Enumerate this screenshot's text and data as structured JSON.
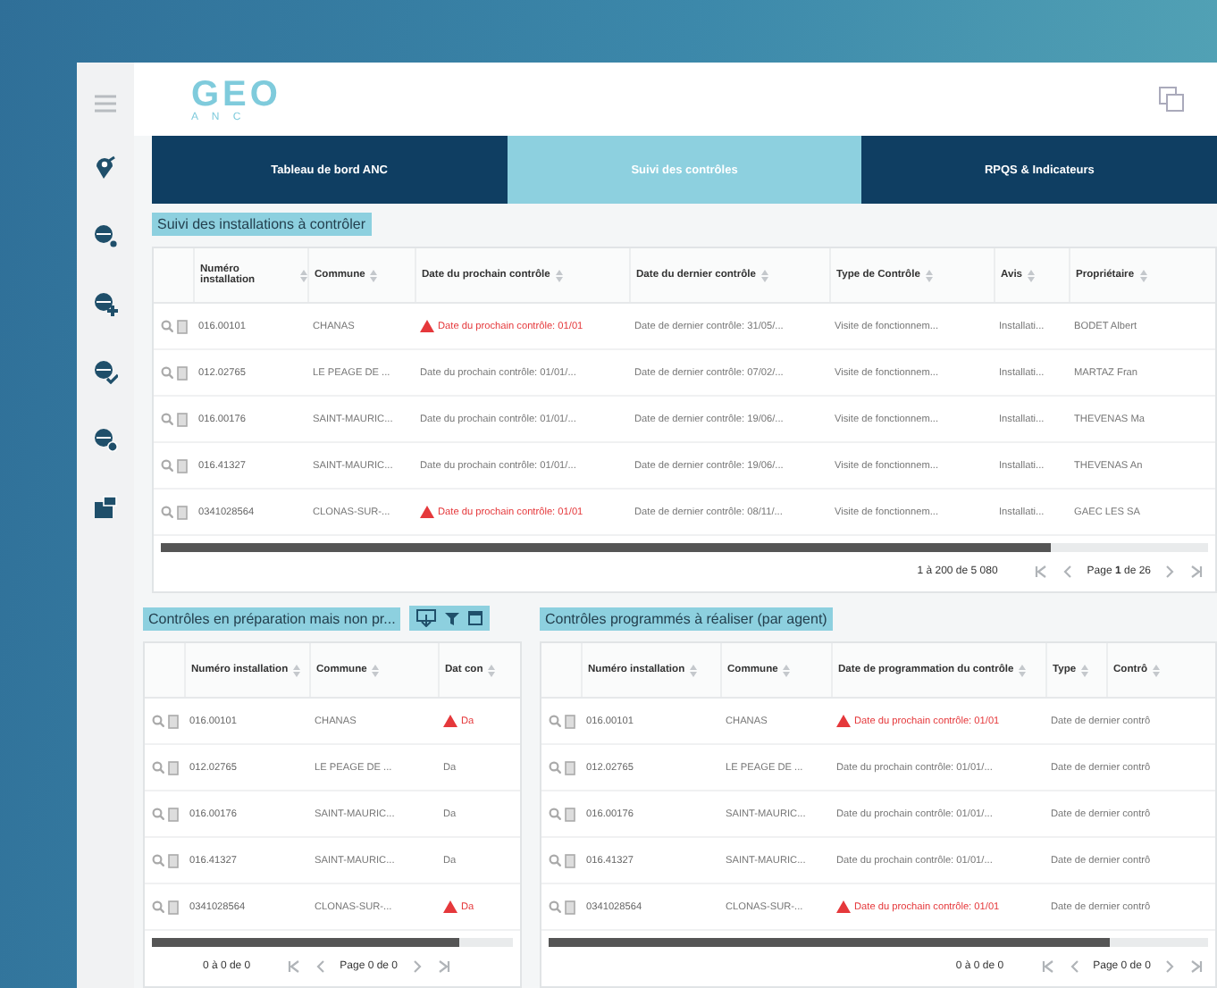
{
  "app": {
    "logo": "GEO",
    "logo_sub": "A N C"
  },
  "tabs": [
    {
      "label": "Tableau de bord ANC",
      "selected": false
    },
    {
      "label": "Suivi des contrôles",
      "selected": true
    },
    {
      "label": "RPQS & Indicateurs",
      "selected": false
    }
  ],
  "panels": [
    {
      "title": "Suivi des installations à contrôler",
      "toolbar": false,
      "columns": [
        {
          "label": "Numéro installation",
          "kind": "text"
        },
        {
          "label": "Commune",
          "kind": "text"
        },
        {
          "label": "Date du prochain contrôle",
          "kind": "due-date"
        },
        {
          "label": "Date du dernier contrôle",
          "kind": "text"
        },
        {
          "label": "Type de Contrôle",
          "kind": "text"
        },
        {
          "label": "Avis",
          "kind": "text"
        },
        {
          "label": "Propriétaire",
          "kind": "text"
        }
      ],
      "rows": [
        {
          "overdue": true,
          "cells": [
            "016.00101",
            "CHANAS",
            "Date du prochain contrôle: 01/01",
            "Date de dernier contrôle: 31/05/...",
            "Visite de fonctionnem...",
            "Installati...",
            "BODET Albert"
          ]
        },
        {
          "overdue": false,
          "cells": [
            "012.02765",
            "LE PEAGE DE ...",
            "Date du prochain contrôle: 01/01/...",
            "Date de dernier contrôle: 07/02/...",
            "Visite de fonctionnem...",
            "Installati...",
            "MARTAZ Fran"
          ]
        },
        {
          "overdue": false,
          "cells": [
            "016.00176",
            "SAINT-MAURIC...",
            "Date du prochain contrôle: 01/01/...",
            "Date de dernier contrôle: 19/06/...",
            "Visite de fonctionnem...",
            "Installati...",
            "THEVENAS Ma"
          ]
        },
        {
          "overdue": false,
          "cells": [
            "016.41327",
            "SAINT-MAURIC...",
            "Date du prochain contrôle: 01/01/...",
            "Date de dernier contrôle: 19/06/...",
            "Visite de fonctionnem...",
            "Installati...",
            "THEVENAS An"
          ]
        },
        {
          "overdue": true,
          "cells": [
            "0341028564",
            "CLONAS-SUR-...",
            "Date du prochain contrôle: 01/01",
            "Date de dernier contrôle: 08/11/...",
            "Visite de fonctionnem...",
            "Installati...",
            "GAEC LES SA"
          ]
        }
      ],
      "footer": {
        "range": "1 à 200 de 5 080",
        "page": "Page **1** de 26"
      }
    },
    {
      "title": "Contrôles en préparation mais non pr...",
      "toolbar": true,
      "columns": [
        {
          "label": "Numéro installation",
          "kind": "text"
        },
        {
          "label": "Commune",
          "kind": "text"
        },
        {
          "label": "Dat con",
          "kind": "due-date"
        }
      ],
      "rows": [
        {
          "overdue": true,
          "cells": [
            "016.00101",
            "CHANAS",
            "Da"
          ]
        },
        {
          "overdue": false,
          "cells": [
            "012.02765",
            "LE PEAGE DE ...",
            "Da"
          ]
        },
        {
          "overdue": false,
          "cells": [
            "016.00176",
            "SAINT-MAURIC...",
            "Da"
          ]
        },
        {
          "overdue": false,
          "cells": [
            "016.41327",
            "SAINT-MAURIC...",
            "Da"
          ]
        },
        {
          "overdue": true,
          "cells": [
            "0341028564",
            "CLONAS-SUR-...",
            "Da"
          ]
        }
      ],
      "footer": {
        "range": "0 à 0 de 0",
        "page": "Page 0 de 0"
      }
    },
    {
      "title": "Contrôles programmés à réaliser (par agent)",
      "toolbar": false,
      "columns": [
        {
          "label": "Numéro installation",
          "kind": "text"
        },
        {
          "label": "Commune",
          "kind": "text"
        },
        {
          "label": "Date de programmation du contrôle",
          "kind": "due-date"
        },
        {
          "label": "Type",
          "kind": "text"
        },
        {
          "label": "Contrô",
          "kind": "text"
        }
      ],
      "rows": [
        {
          "overdue": true,
          "cells": [
            "016.00101",
            "CHANAS",
            "Date du prochain contrôle: 01/01",
            "Date de dernier contrô"
          ]
        },
        {
          "overdue": false,
          "cells": [
            "012.02765",
            "LE PEAGE DE ...",
            "Date du prochain contrôle: 01/01/...",
            "Date de dernier contrô"
          ]
        },
        {
          "overdue": false,
          "cells": [
            "016.00176",
            "SAINT-MAURIC...",
            "Date du prochain contrôle: 01/01/...",
            "Date de dernier contrô"
          ]
        },
        {
          "overdue": false,
          "cells": [
            "016.41327",
            "SAINT-MAURIC...",
            "Date du prochain contrôle: 01/01/...",
            "Date de dernier contrô"
          ]
        },
        {
          "overdue": true,
          "cells": [
            "0341028564",
            "CLONAS-SUR-...",
            "Date du prochain contrôle: 01/01",
            "Date de dernier contrô"
          ]
        }
      ],
      "footer": {
        "range": "0 à 0 de 0",
        "page": "Page 0 de 0"
      }
    }
  ]
}
